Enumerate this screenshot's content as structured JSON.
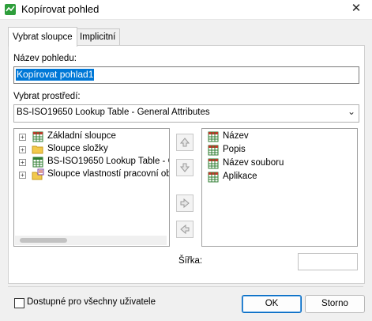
{
  "window": {
    "title": "Kopírovat pohled",
    "app_icon": "copy-view-icon"
  },
  "tabs": [
    {
      "label": "Vybrat sloupce",
      "active": true
    },
    {
      "label": "Implicitní",
      "active": false
    }
  ],
  "form": {
    "name_label": "Název pohledu:",
    "name_value": "Kopírovat pohlad1",
    "env_label": "Vybrat prostředí:",
    "env_value": "BS-ISO19650 Lookup Table - General Attributes",
    "width_label": "Šířka:",
    "width_value": ""
  },
  "available": {
    "items": [
      {
        "label": "Základní sloupce",
        "icon": "table-grid-icon"
      },
      {
        "label": "Sloupce složky",
        "icon": "folder-icon"
      },
      {
        "label": "BS-ISO19650 Lookup Table - Ge",
        "icon": "table-grid-icon"
      },
      {
        "label": "Sloupce vlastností pracovní obla",
        "icon": "workspace-properties-icon"
      }
    ]
  },
  "selected": {
    "items": [
      {
        "label": "Název",
        "icon": "table-grid-icon"
      },
      {
        "label": "Popis",
        "icon": "table-grid-icon"
      },
      {
        "label": "Název souboru",
        "icon": "table-grid-icon"
      },
      {
        "label": "Aplikace",
        "icon": "table-grid-icon"
      }
    ]
  },
  "footer": {
    "all_users_label": "Dostupné pro všechny uživatele",
    "all_users_checked": false,
    "ok_label": "OK",
    "cancel_label": "Storno"
  },
  "colors": {
    "selection": "#0078d7",
    "accent_button": "#0067c0",
    "title_icon": "#2e9e3b"
  }
}
